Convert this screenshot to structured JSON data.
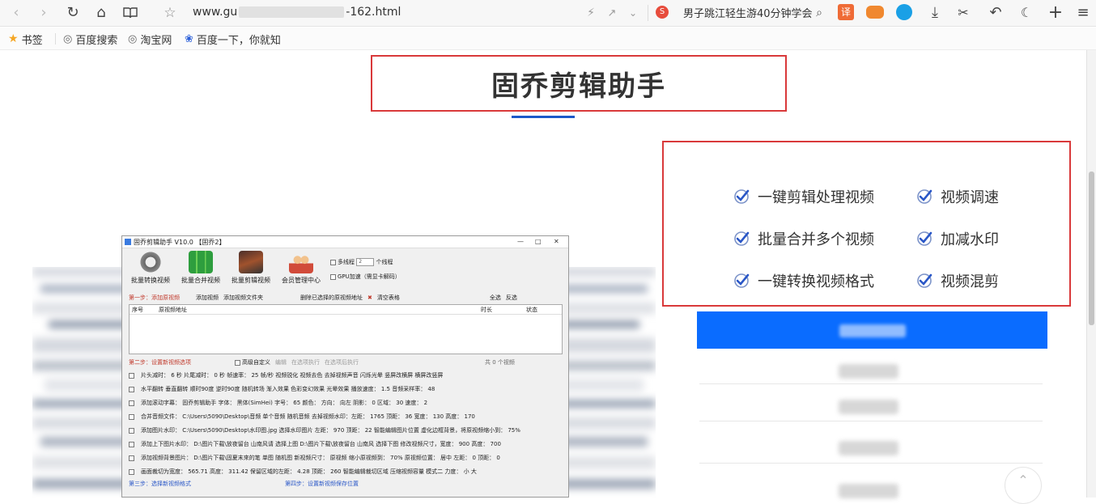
{
  "browser": {
    "url_prefix": "www.gu",
    "url_suffix": "-162.html",
    "search_text": "男子跳江轻生游40分钟学会",
    "bookmarks": [
      {
        "label": "书签",
        "icon": "star-icon"
      },
      {
        "label": "百度搜索",
        "icon": "globe-icon"
      },
      {
        "label": "淘宝网",
        "icon": "globe-icon"
      },
      {
        "label": "百度一下，你就知",
        "icon": "paw-icon"
      }
    ]
  },
  "page": {
    "title": "固乔剪辑助手",
    "features": [
      {
        "label": "一键剪辑处理视频"
      },
      {
        "label": "视频调速"
      },
      {
        "label": "批量合并多个视频"
      },
      {
        "label": "加减水印"
      },
      {
        "label": "一键转换视频格式"
      },
      {
        "label": "视频混剪"
      }
    ],
    "colors": {
      "accent": "#0a6cff",
      "highlight_border": "#d9393a",
      "underline": "#1b59c9"
    }
  },
  "app_screenshot": {
    "window_title": "固乔剪辑助手 V10.0  【固乔2】",
    "tools": [
      "批量转换视频",
      "批量合并视频",
      "批量剪辑视频",
      "会员管理中心"
    ],
    "multithread_label": "多线程",
    "thread_count": "2",
    "thread_unit": "个线程",
    "gpu_label": "GPU加速（需显卡解码）",
    "step1": "第一步：添加原视频",
    "add_video": "添加视频",
    "add_folder": "添加视频文件夹",
    "delete_selected": "删除已选择的原视频地址",
    "clear_table": "清空表格",
    "select_all": "全选",
    "invert": "反选",
    "col_index": "序号",
    "col_path": "原视频地址",
    "col_duration": "时长",
    "col_status": "状态",
    "step2": "第二步：设置新视频选项",
    "advanced": "高级自定义",
    "edit": "编辑",
    "exec_now": "在选项执行",
    "exec_all": "在选项后执行",
    "total": "共 0 个视频",
    "opt_row1": "片头减时： 6 秒   片尾减时： 0 秒   帧速率： 25 帧/秒   视频锐化   视频去色   去掉视频声音   闪烁光晕   竖屏改横屏   横屏改竖屏",
    "opt_row2": "水平翻转   垂直翻转   顺时90度   逆时90度   随机转场   渐入效果   色彩变幻效果   光晕效果   播放速度： 1.5   音频采样率： 48",
    "opt_row3": "添加滚动字幕： 固乔剪辑助手   字体： 黑体(SimHei)   字号： 65   颜色：   方向： 向左   阴影： 0   区域： 30   速度： 2",
    "opt_row4": "合并音频文件： C:\\Users\\5090\\Desktop\\音频   单个音频   随机音频   去掉视频水印：左距： 1765   顶距： 36   宽度： 130   高度： 170",
    "opt_row5": "添加图片水印： C:\\Users\\5090\\Desktop\\水印图.jpg   选择水印图片   左距： 970   顶距： 22   智能编辑图片位置   虚化边框背景，将原视频缩小到： 75%",
    "opt_row6": "添加上下图片水印： D:\\图片下载\\放夜留台 山南风请   选择上图   D:\\图片下载\\放夜留台 山南风   选择下图   修改视频尺寸，宽度： 900   高度： 700",
    "opt_row7": "添加视频背景图片： D:\\图片下载\\固夏末來的笔   单图   随机图   新视频尺寸： 原视频   缩小原视频到： 70%   原视频位置： 居中   左距： 0   顶距： 0",
    "opt_row8": "画面裁切为宽度： 565.71   高度： 311.42   保留区域的左距： 4.28   顶距： 260   智能编辑裁切区域   压缩视频容量   模式二   力度： 小   大",
    "step3": "第三步：选择新视频格式",
    "step4": "第四步：设置新视频保存位置"
  }
}
